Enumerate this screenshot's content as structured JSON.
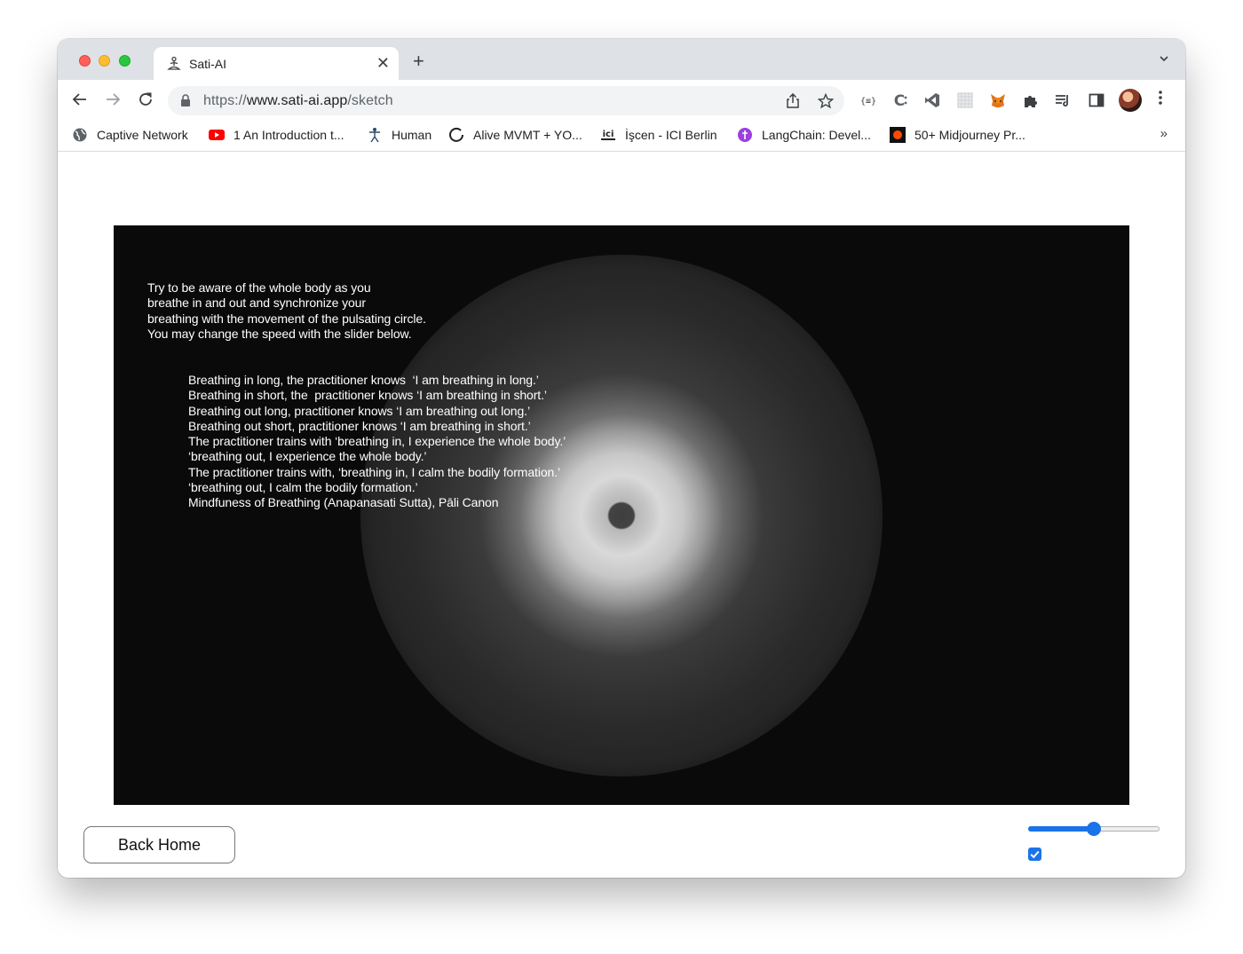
{
  "browser": {
    "tab": {
      "title": "Sati-AI",
      "favicon": "meditation-figure-icon"
    },
    "url": {
      "prefix": "https://",
      "domain": "www.sati-ai.app",
      "path": "/sketch"
    },
    "bookmarks": [
      {
        "label": "Captive Network",
        "icon": "globe-icon"
      },
      {
        "label": "1 An Introduction t...",
        "icon": "youtube-icon"
      },
      {
        "label": "Human",
        "icon": "human-figure-icon"
      },
      {
        "label": "Alive MVMT + YO...",
        "icon": "circle-logo-icon"
      },
      {
        "label": "İşcen - ICI Berlin",
        "icon": "ici-logo-icon"
      },
      {
        "label": "LangChain: Devel...",
        "icon": "langchain-icon"
      },
      {
        "label": "50+ Midjourney Pr...",
        "icon": "midjourney-icon"
      }
    ],
    "bookmarks_more": "»",
    "colors": {
      "accent": "#1a73e8"
    }
  },
  "page": {
    "instructions": [
      "Try to be aware of the whole body as you",
      "breathe in and out and synchronize your",
      "breathing with the movement of the pulsating circle.",
      "You may change the speed with the slider below."
    ],
    "quote": [
      "Breathing in long, the practitioner knows  ‘I am breathing in long.’",
      "Breathing in short, the  practitioner knows ‘I am breathing in short.’",
      "Breathing out long, practitioner knows ‘I am breathing out long.’",
      "Breathing out short, practitioner knows ‘I am breathing in short.’",
      "The practitioner trains with ‘breathing in, I experience the whole body.’",
      "‘breathing out, I experience the whole body.’",
      "The practitioner trains with, ‘breathing in, I calm the bodily formation.’",
      "‘breathing out, I calm the bodily formation.’",
      "Mindfuness of Breathing (Anapanasati Sutta), Pāli Canon"
    ],
    "back_button": "Back Home",
    "speed_slider": {
      "value_fraction": 0.5
    },
    "checkbox": {
      "checked": true
    }
  }
}
